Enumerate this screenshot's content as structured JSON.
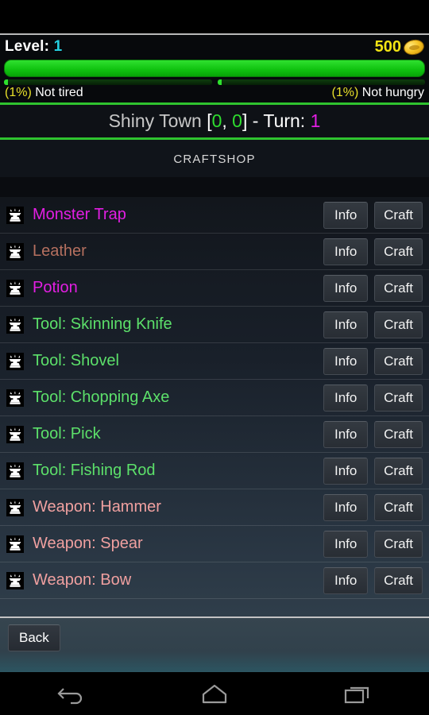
{
  "statusbar": {
    "empty": ""
  },
  "stats": {
    "level_label": "Level:",
    "level_value": "1",
    "gold_amount": "500",
    "gold_icon": "coin-icon",
    "health_percent": 100,
    "tired": {
      "percent_text": "(1%)",
      "label": "Not tired",
      "percent": 1
    },
    "hungry": {
      "percent_text": "(1%)",
      "label": "Not hungry",
      "percent": 1
    }
  },
  "header": {
    "town_name": "Shiny Town",
    "bracket_open": "[",
    "coord_x": "0",
    "coord_sep": ", ",
    "coord_y": "0",
    "bracket_close": "]",
    "turn_label": " - Turn: ",
    "turn_value": "1",
    "shop_title": "CRAFTSHOP"
  },
  "list": {
    "icon": "anvil-icon",
    "info_label": "Info",
    "craft_label": "Craft",
    "items": [
      {
        "name": "Monster Trap",
        "color": "#e31ee3"
      },
      {
        "name": "Leather",
        "color": "#b5705f"
      },
      {
        "name": "Potion",
        "color": "#e31ee3"
      },
      {
        "name": "Tool: Skinning Knife",
        "color": "#5ce06a"
      },
      {
        "name": "Tool: Shovel",
        "color": "#5ce06a"
      },
      {
        "name": "Tool: Chopping Axe",
        "color": "#5ce06a"
      },
      {
        "name": "Tool: Pick",
        "color": "#5ce06a"
      },
      {
        "name": "Tool: Fishing Rod",
        "color": "#5ce06a"
      },
      {
        "name": "Weapon: Hammer",
        "color": "#f0a0a0"
      },
      {
        "name": "Weapon: Spear",
        "color": "#f0a0a0"
      },
      {
        "name": "Weapon: Bow",
        "color": "#f0a0a0"
      }
    ]
  },
  "footer": {
    "back_label": "Back"
  },
  "navbar": {
    "back": "back-arrow-icon",
    "home": "home-icon",
    "recents": "recents-icon"
  }
}
